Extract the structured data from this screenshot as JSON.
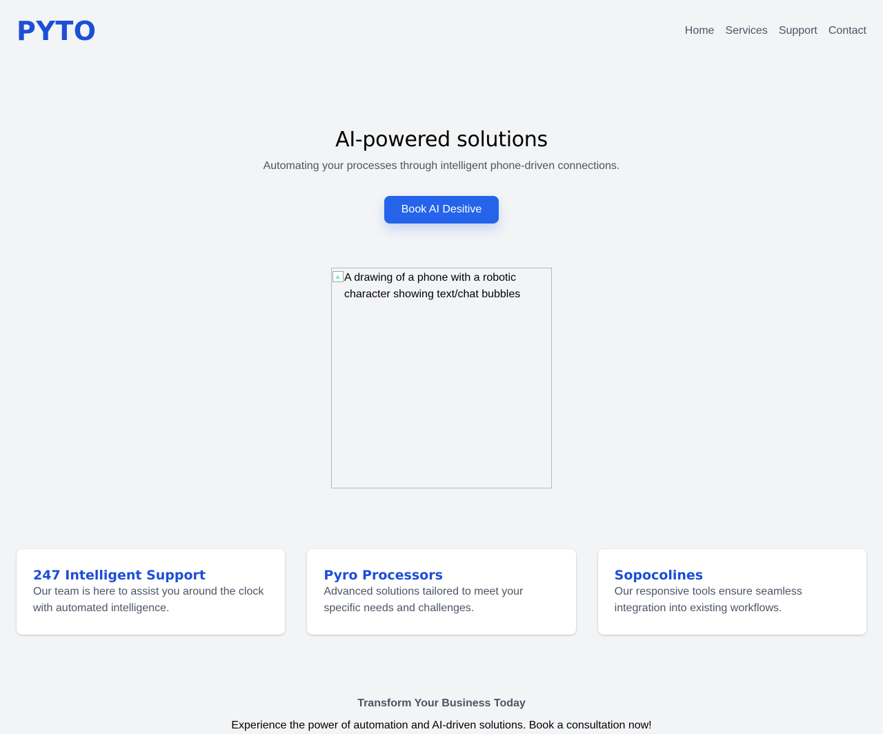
{
  "brand": {
    "name": "PYTO",
    "accent_color": "#1d4ed8",
    "button_color": "#2563eb"
  },
  "nav": {
    "items": [
      {
        "label": "Home"
      },
      {
        "label": "Services"
      },
      {
        "label": "Support"
      },
      {
        "label": "Contact"
      }
    ]
  },
  "hero": {
    "title": "AI-powered solutions",
    "subtitle": "Automating your processes through intelligent phone-driven connections.",
    "cta_label": "Book AI Desitive",
    "image_alt": "A drawing of a phone with a robotic character showing text/chat bubbles",
    "image_icon": "broken-image-icon"
  },
  "features": [
    {
      "title": "247 Intelligent Support",
      "text": "Our team is here to assist you around the clock with automated intelligence."
    },
    {
      "title": "Pyro Processors",
      "text": "Advanced solutions tailored to meet your specific needs and challenges."
    },
    {
      "title": "Sopocolines",
      "text": "Our responsive tools ensure seamless integration into existing workflows."
    }
  ],
  "footer_cta": {
    "title": "Transform Your Business Today",
    "text": "Experience the power of automation and AI-driven solutions. Book a consultation now!"
  }
}
